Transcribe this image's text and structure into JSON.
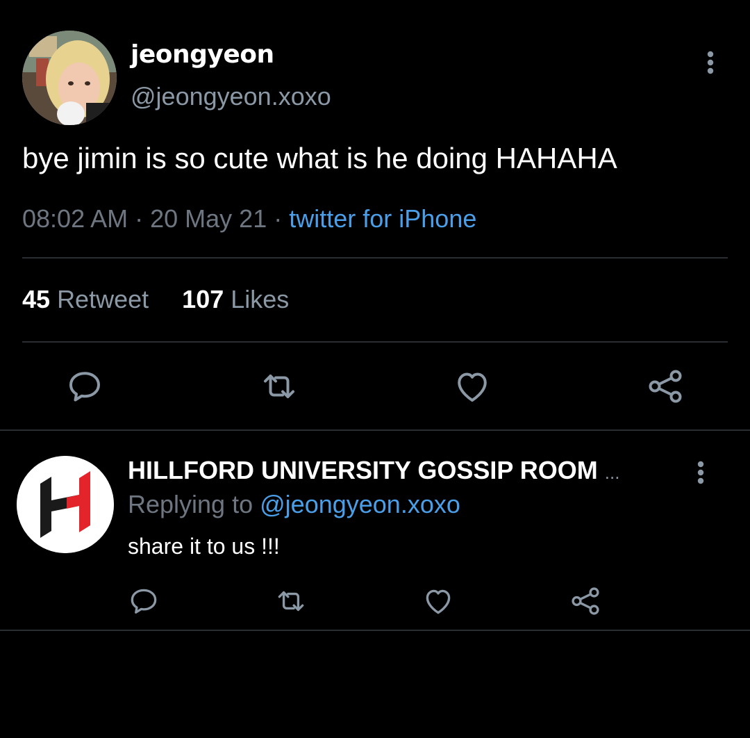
{
  "tweet": {
    "display_name": "jeongyeon",
    "handle": "@jeongyeon.xoxo",
    "text": "bye jimin is so cute what is he doing HAHAHA",
    "time": "08:02 AM",
    "date": "20 May 21",
    "source": "twitter for iPhone",
    "retweets_count": "45",
    "retweets_label": "Retweet",
    "likes_count": "107",
    "likes_label": "Likes",
    "actions": [
      "comment-icon",
      "retweet-icon",
      "heart-icon",
      "share-icon"
    ]
  },
  "reply": {
    "display_name": "HILLFORD UNIVERSITY GOSSIP ROOM",
    "ellipsis": "...",
    "replying_prefix": "Replying to",
    "replying_to": "@jeongyeon.xoxo",
    "text": "share it to us !!!",
    "avatar_letter_colors": [
      "#1a1a1a",
      "#e3242b"
    ],
    "actions": [
      "comment-icon",
      "retweet-icon",
      "heart-icon",
      "share-icon"
    ]
  },
  "colors": {
    "background": "#000000",
    "primary_text": "#ffffff",
    "secondary_text": "#6e7781",
    "link": "#4a9fe8",
    "divider": "#2a2d31"
  }
}
